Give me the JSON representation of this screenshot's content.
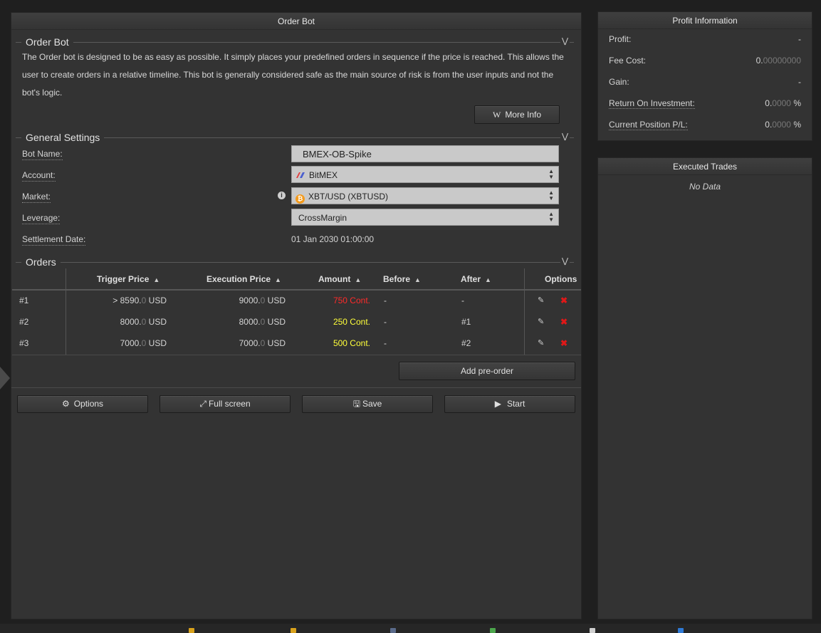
{
  "main_panel": {
    "title": "Order Bot",
    "intro_section_title": "Order Bot",
    "description": "The Order bot is designed to be as easy as possible. It simply places your predefined orders in sequence if the price is reached. This allows the user to create orders in a relative timeline. This bot is generally considered safe as the main source of risk is from the user inputs and not the bot's logic.",
    "more_info_label": "More Info",
    "more_info_icon": "W",
    "general_settings_title": "General Settings",
    "fields": {
      "bot_name_label": "Bot Name:",
      "bot_name_value": "BMEX-OB-Spike",
      "account_label": "Account:",
      "account_value": "BitMEX",
      "market_label": "Market:",
      "market_value": "XBT/USD (XBTUSD)",
      "leverage_label": "Leverage:",
      "leverage_value": "CrossMargin",
      "settlement_label": "Settlement Date:",
      "settlement_value": "01 Jan 2030 01:00:00"
    },
    "orders_title": "Orders",
    "orders": {
      "headers": {
        "trigger": "Trigger Price",
        "execution": "Execution Price",
        "amount": "Amount",
        "before": "Before",
        "after": "After",
        "options": "Options"
      },
      "rows": [
        {
          "id": "#1",
          "trigger_prefix": ">",
          "trigger_int": "8590.",
          "trigger_dec": "0",
          "trigger_unit": "USD",
          "exec_int": "9000.",
          "exec_dec": "0",
          "exec_unit": "USD",
          "amount": "750 Cont.",
          "before": "-",
          "after": "-"
        },
        {
          "id": "#2",
          "trigger_prefix": "",
          "trigger_int": "8000.",
          "trigger_dec": "0",
          "trigger_unit": "USD",
          "exec_int": "8000.",
          "exec_dec": "0",
          "exec_unit": "USD",
          "amount": "250 Cont.",
          "before": "-",
          "after": "#1"
        },
        {
          "id": "#3",
          "trigger_prefix": "",
          "trigger_int": "7000.",
          "trigger_dec": "0",
          "trigger_unit": "USD",
          "exec_int": "7000.",
          "exec_dec": "0",
          "exec_unit": "USD",
          "amount": "500 Cont.",
          "before": "-",
          "after": "#2"
        }
      ],
      "add_preorder_label": "Add pre-order"
    },
    "actions": {
      "options_label": "Options",
      "fullscreen_label": "Full screen",
      "save_label": "Save",
      "start_label": "Start"
    }
  },
  "profit_panel": {
    "title": "Profit Information",
    "profit_label": "Profit:",
    "profit_value": "-",
    "fee_label": "Fee Cost:",
    "fee_int": "0.",
    "fee_dec": "00000000",
    "gain_label": "Gain:",
    "gain_value": "-",
    "roi_label": "Return On Investment:",
    "roi_int": "0.",
    "roi_dec": "0000",
    "roi_unit": "%",
    "pl_label": "Current Position P/L:",
    "pl_int": "0.",
    "pl_dec": "0000",
    "pl_unit": "%"
  },
  "trades_panel": {
    "title": "Executed Trades",
    "empty_text": "No Data"
  },
  "colors": {
    "amount_red": "#ff2a2a",
    "amount_yellow": "#ffff3a",
    "delete_red": "#e01818"
  }
}
